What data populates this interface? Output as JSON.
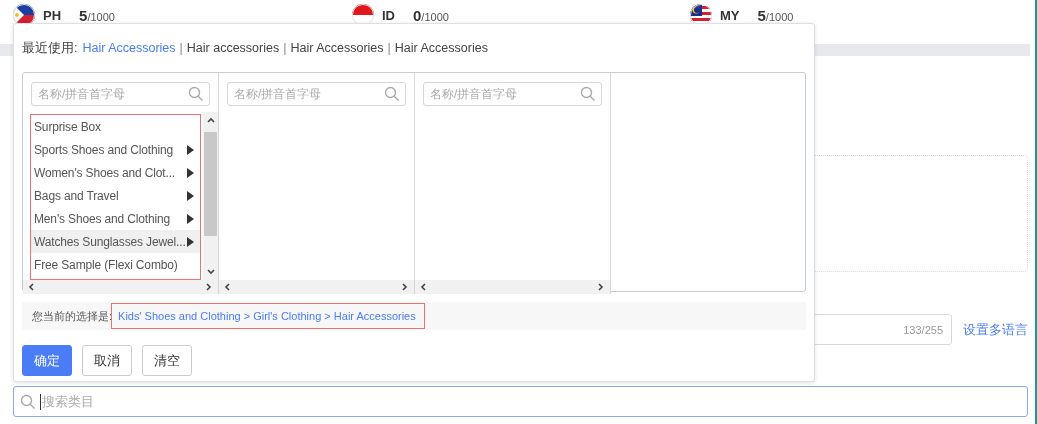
{
  "header": {
    "sites": [
      {
        "code": "PH",
        "count": "5",
        "limit": "/1000",
        "kind": "ph"
      },
      {
        "code": "ID",
        "count": "0",
        "limit": "/1000",
        "kind": "id"
      },
      {
        "code": "MY",
        "count": "5",
        "limit": "/1000",
        "kind": "my"
      }
    ]
  },
  "category_picker": {
    "recent_label": "最近使用:",
    "separators": [
      "|",
      "|",
      "|"
    ],
    "recent": [
      {
        "label": "Hair Accessories",
        "selected": true
      },
      {
        "label": "Hair accessories",
        "selected": false
      },
      {
        "label": "Hair Accessories",
        "selected": false
      },
      {
        "label": "Hair Accessories",
        "selected": false
      }
    ],
    "columns": [
      {
        "placeholder": "名称/拼音首字母",
        "items": [
          {
            "label": "Surprise Box",
            "has_children": false,
            "hovered": false
          },
          {
            "label": "Sports Shoes and Clothing",
            "has_children": true,
            "hovered": false
          },
          {
            "label": "Women's Shoes and Clot...",
            "has_children": true,
            "hovered": false
          },
          {
            "label": "Bags and Travel",
            "has_children": true,
            "hovered": false
          },
          {
            "label": "Men's Shoes and Clothing",
            "has_children": true,
            "hovered": false
          },
          {
            "label": "Watches Sunglasses Jewel...",
            "has_children": true,
            "hovered": true
          },
          {
            "label": "Free Sample (Flexi Combo)",
            "has_children": false,
            "hovered": false
          }
        ]
      },
      {
        "placeholder": "名称/拼音首字母"
      },
      {
        "placeholder": "名称/拼音首字母"
      }
    ],
    "selection_label": "您当前的选择是:",
    "selection_path": "Kids' Shoes and Clothing > Girl's Clothing > Hair Accessories",
    "buttons": [
      {
        "label": "确定",
        "kind": "primary"
      },
      {
        "label": "取消",
        "kind": "default"
      },
      {
        "label": "清空",
        "kind": "default"
      }
    ]
  },
  "form": {
    "title_counter": "133/255",
    "multilang_link": "设置多语言",
    "search": {
      "placeholder": "搜索类目",
      "focused": true
    }
  }
}
